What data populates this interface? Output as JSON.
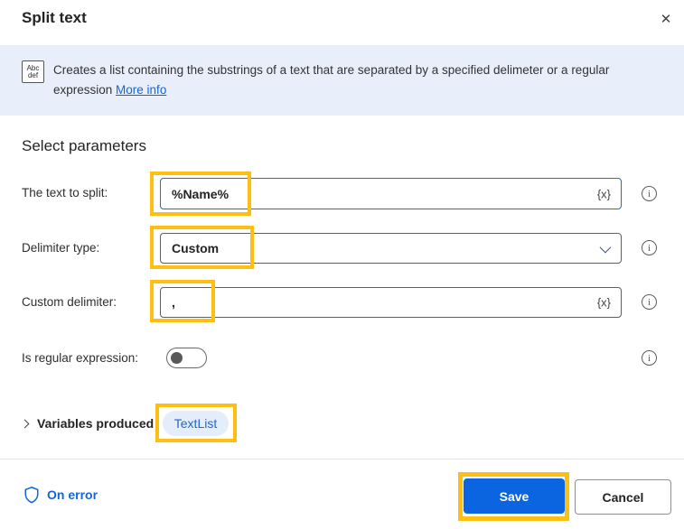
{
  "dialog": {
    "title": "Split text",
    "close_icon": "✕"
  },
  "banner": {
    "icon_top": "Abc",
    "icon_bottom": "def",
    "description": "Creates a list containing the substrings of a text that are separated by a specified delimeter or a regular expression ",
    "link_label": "More info"
  },
  "section": {
    "heading": "Select parameters"
  },
  "fields": {
    "text_to_split": {
      "label": "The text to split:",
      "value": "%Name%",
      "fx": "{x}",
      "info": "i"
    },
    "delimiter_type": {
      "label": "Delimiter type:",
      "value": "Custom",
      "info": "i"
    },
    "custom_delimiter": {
      "label": "Custom delimiter:",
      "value": ",",
      "fx": "{x}",
      "info": "i"
    },
    "is_regex": {
      "label": "Is regular expression:",
      "state": "off",
      "info": "i"
    }
  },
  "variables": {
    "label": "Variables produced",
    "pill": "TextList"
  },
  "footer": {
    "on_error": "On error",
    "save": "Save",
    "cancel": "Cancel"
  },
  "colors": {
    "accent": "#1565d8",
    "save_bg": "#0b64e0",
    "highlight": "#fcbf12",
    "banner_bg": "#e8effa",
    "focus_border": "#2667d9"
  }
}
